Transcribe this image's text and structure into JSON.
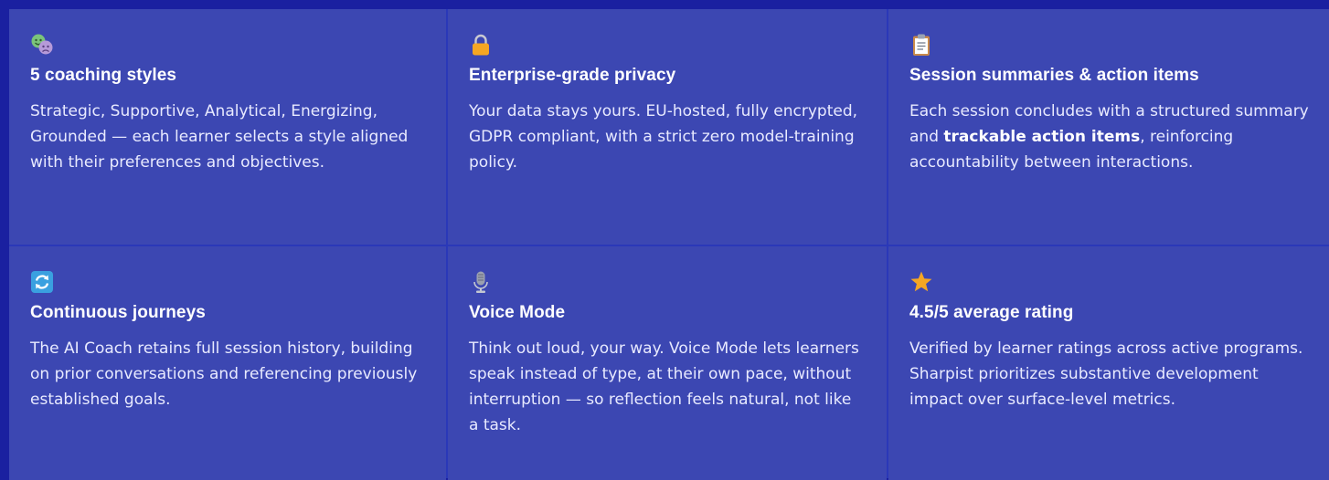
{
  "features": [
    {
      "icon": "theater-masks-icon",
      "title": "5 coaching styles",
      "desc": "Strategic, Supportive, Analytical, Energizing, Grounded — each learner selects a style aligned with their preferences and objectives."
    },
    {
      "icon": "lock-icon",
      "title": "Enterprise-grade privacy",
      "desc": "Your data stays yours. EU-hosted, fully encrypted, GDPR compliant, with a strict zero model-training policy."
    },
    {
      "icon": "clipboard-icon",
      "title": "Session summaries & action items",
      "desc_before": "Each session concludes with a structured summary and ",
      "desc_bold": "trackable action items",
      "desc_after": ", reinforcing accountability between interactions."
    },
    {
      "icon": "refresh-icon",
      "title": "Continuous journeys",
      "desc": "The AI Coach retains full session history, building on prior conversations and referencing previously established goals."
    },
    {
      "icon": "microphone-icon",
      "title": "Voice Mode",
      "desc": "Think out loud, your way. Voice Mode lets learners speak instead of type, at their own pace, without interruption — so reflection feels natural, not like a task."
    },
    {
      "icon": "star-icon",
      "title": "4.5/5 average rating",
      "desc": "Verified by learner ratings across active programs. Sharpist prioritizes substantive development impact over surface-level metrics."
    }
  ],
  "colors": {
    "background": "#1a20a0",
    "card": "#3c47b2",
    "divider": "#2a38b8",
    "star": "#f5a623",
    "lock": "#f5a623"
  }
}
